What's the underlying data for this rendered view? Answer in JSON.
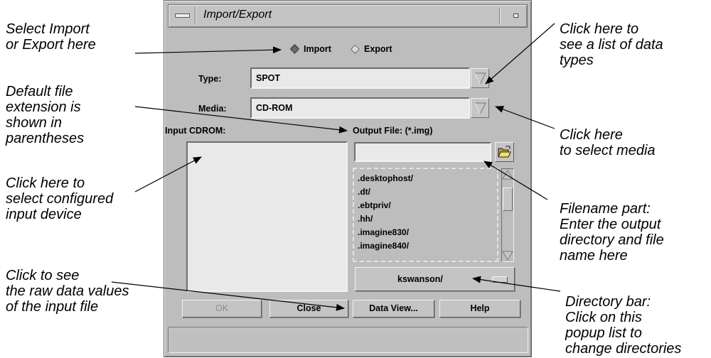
{
  "annotations": {
    "select_import_export": "Select Import\nor Export here",
    "default_extension": "Default file\nextension is\nshown in\nparentheses",
    "select_input_device": "Click here to\nselect configured\ninput device",
    "raw_data": "Click to see\nthe raw data values\nof the input file",
    "data_types": "Click here to\nsee a list of data\ntypes",
    "select_media": "Click here\nto select media",
    "filename_part": "Filename part:\nEnter the output\ndirectory and file\nname here",
    "directory_bar": "Directory bar:\nClick on this\npopup list to\nchange directories"
  },
  "window": {
    "title": "Import/Export"
  },
  "mode": {
    "import_label": "Import",
    "export_label": "Export",
    "selected": "Import"
  },
  "type": {
    "label": "Type:",
    "value": "SPOT"
  },
  "media": {
    "label": "Media:",
    "value": "CD-ROM"
  },
  "input": {
    "label": "Input CDROM:"
  },
  "output": {
    "label": "Output File: (*.img)",
    "filename": "",
    "files": [
      ".desktophost/",
      ".dt/",
      ".ebtpriv/",
      ".hh/",
      ".imagine830/",
      ".imagine840/"
    ],
    "directory": "kswanson/"
  },
  "buttons": {
    "ok": "OK",
    "close": "Close",
    "data_view": "Data View...",
    "help": "Help"
  },
  "icons": {
    "menu": "window-menu-icon",
    "minimize": "minimize-icon",
    "dropdown": "triangle-down-icon",
    "folder": "open-folder-icon",
    "popup": "popup-indicator-icon"
  }
}
